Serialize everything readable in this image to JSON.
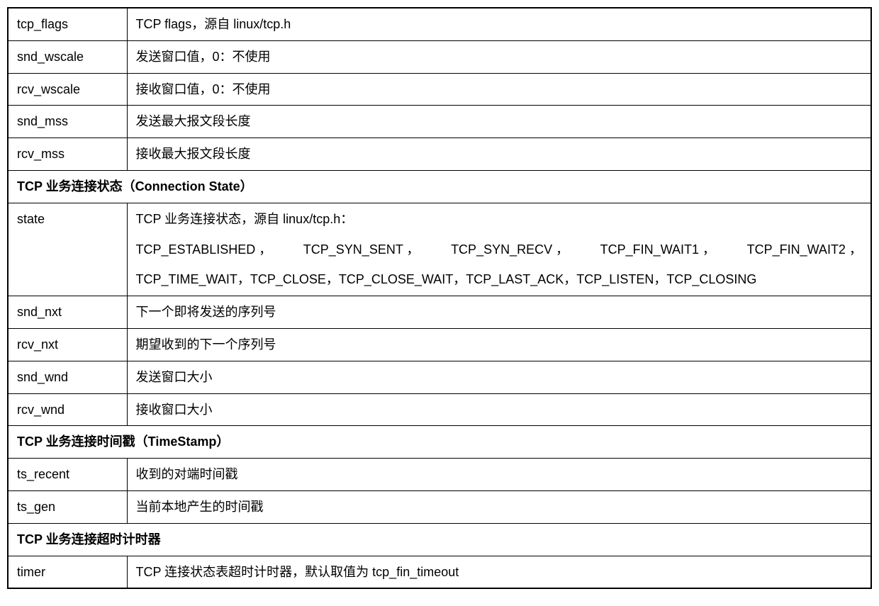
{
  "rows": {
    "tcp_flags": {
      "key": "tcp_flags",
      "desc": "TCP flags，源自 linux/tcp.h"
    },
    "snd_wscale": {
      "key": "snd_wscale",
      "desc": "发送窗口值，0：不使用"
    },
    "rcv_wscale": {
      "key": "rcv_wscale",
      "desc": "接收窗口值，0：不使用"
    },
    "snd_mss": {
      "key": "snd_mss",
      "desc": "发送最大报文段长度"
    },
    "rcv_mss": {
      "key": "rcv_mss",
      "desc": "接收最大报文段长度"
    },
    "section_conn": "TCP 业务连接状态（Connection State）",
    "state": {
      "key": "state",
      "line1": "TCP 业务连接状态，源自 linux/tcp.h：",
      "line2_parts": {
        "p1": "TCP_ESTABLISHED ，",
        "p2": "TCP_SYN_SENT ，",
        "p3": "TCP_SYN_RECV ，",
        "p4": "TCP_FIN_WAIT1 ，",
        "p5": "TCP_FIN_WAIT2 ，"
      },
      "line3": "TCP_TIME_WAIT，TCP_CLOSE，TCP_CLOSE_WAIT，TCP_LAST_ACK，TCP_LISTEN，TCP_CLOSING"
    },
    "snd_nxt": {
      "key": "snd_nxt",
      "desc": "下一个即将发送的序列号"
    },
    "rcv_nxt": {
      "key": "rcv_nxt",
      "desc": "期望收到的下一个序列号"
    },
    "snd_wnd": {
      "key": "snd_wnd",
      "desc": "发送窗口大小"
    },
    "rcv_wnd": {
      "key": "rcv_wnd",
      "desc": "接收窗口大小"
    },
    "section_ts": "TCP 业务连接时间戳（TimeStamp）",
    "ts_recent": {
      "key": "ts_recent",
      "desc": "收到的对端时间戳"
    },
    "ts_gen": {
      "key": "ts_gen",
      "desc": "当前本地产生的时间戳"
    },
    "section_timer": "TCP 业务连接超时计时器",
    "timer": {
      "key": "timer",
      "desc": "TCP 连接状态表超时计时器，默认取值为 tcp_fin_timeout"
    }
  }
}
